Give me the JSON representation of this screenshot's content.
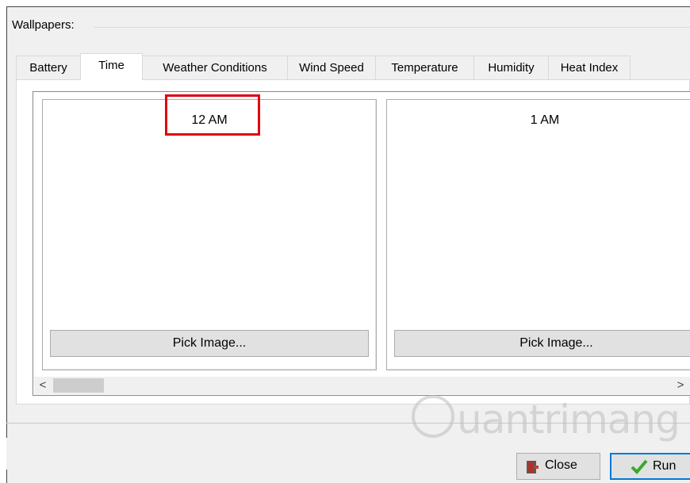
{
  "window": {
    "group_title": "Wallpapers:",
    "tabs": [
      {
        "label": "Battery",
        "active": false
      },
      {
        "label": "Time",
        "active": true
      },
      {
        "label": "Weather Conditions",
        "active": false
      },
      {
        "label": "Wind Speed",
        "active": false
      },
      {
        "label": "Temperature",
        "active": false
      },
      {
        "label": "Humidity",
        "active": false
      },
      {
        "label": "Heat Index",
        "active": false
      }
    ],
    "panels": [
      {
        "time_label": "12 AM",
        "button_label": "Pick Image..."
      },
      {
        "time_label": "1 AM",
        "button_label": "Pick Image..."
      }
    ],
    "scrollbar": {
      "left_arrow": "<",
      "right_arrow": ">"
    },
    "footer": {
      "close_label": "Close",
      "run_label": "Run"
    },
    "highlight_color": "#e3000f",
    "accent_color": "#0078d7"
  },
  "watermark": {
    "text": "uantrimang"
  }
}
